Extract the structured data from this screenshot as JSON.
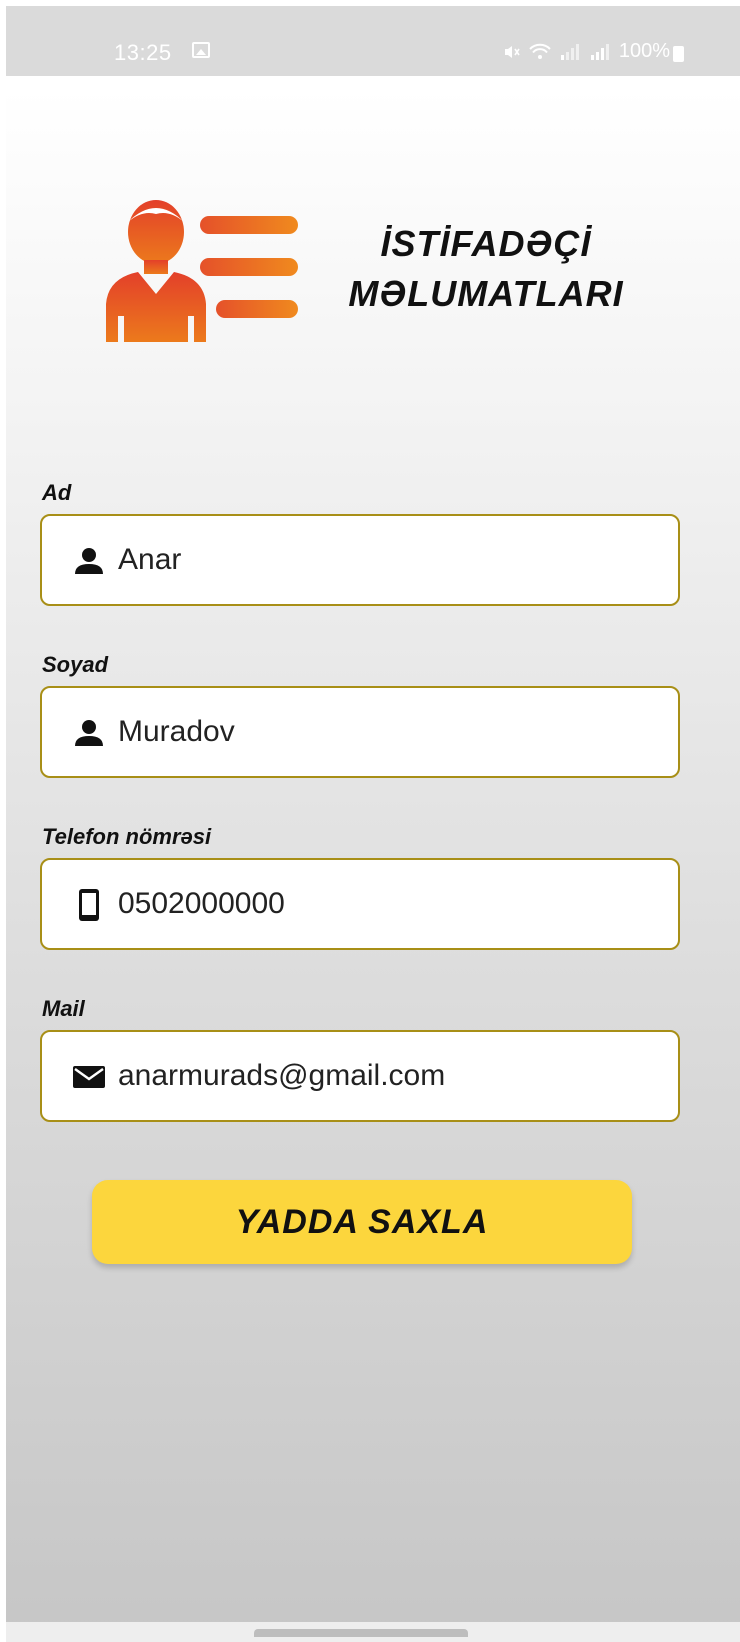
{
  "status_bar": {
    "time": "13:25",
    "battery": "100%"
  },
  "header": {
    "title_line1": "İSTİFADƏÇİ",
    "title_line2": "MƏLUMATLARI",
    "logo_icon": "user-profile-list-icon"
  },
  "form": {
    "fields": [
      {
        "label": "Ad",
        "value": "Anar",
        "icon": "person-icon"
      },
      {
        "label": "Soyad",
        "value": "Muradov",
        "icon": "person-icon"
      },
      {
        "label": "Telefon nömrəsi",
        "value": "0502000000",
        "icon": "phone-icon"
      },
      {
        "label": "Mail",
        "value": "anarmurads@gmail.com",
        "icon": "mail-icon"
      }
    ],
    "save_label": "YADDA SAXLA"
  },
  "colors": {
    "field_border": "#a88f17",
    "button": "#fcd63d",
    "logo_orange": "#e8661e"
  }
}
